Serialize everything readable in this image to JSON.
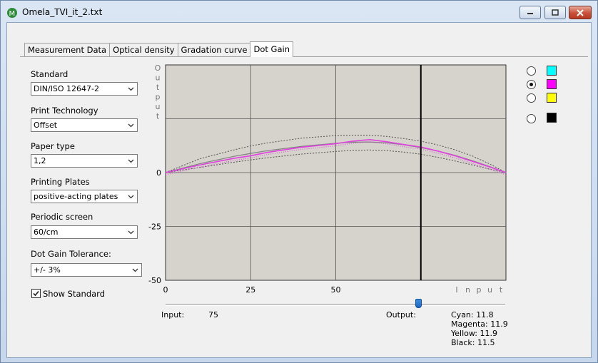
{
  "window": {
    "title": "Omela_TVI_it_2.txt",
    "minimize_icon": "minimize-icon",
    "maximize_icon": "maximize-icon",
    "close_icon": "close-icon",
    "app_icon": "omela-app-icon"
  },
  "tabs": [
    {
      "label": "Measurement Data",
      "active": false
    },
    {
      "label": "Optical density",
      "active": false
    },
    {
      "label": "Gradation curve",
      "active": false
    },
    {
      "label": "Dot Gain",
      "active": true
    }
  ],
  "form": {
    "standard_label": "Standard",
    "standard_value": "DIN/ISO 12647-2",
    "print_tech_label": "Print Technology",
    "print_tech_value": "Offset",
    "paper_type_label": "Paper type",
    "paper_type_value": "1,2",
    "printing_plates_label": "Printing Plates",
    "printing_plates_value": "positive-acting plates",
    "periodic_screen_label": "Periodic screen",
    "periodic_screen_value": "60/cm",
    "tolerance_label": "Dot Gain Tolerance:",
    "tolerance_value": "+/- 3%",
    "show_standard_label": "Show Standard",
    "show_standard_checked": true
  },
  "colors": {
    "plot_bg": "#d6d3cc",
    "grid": "#555555",
    "magenta_curve": "#e040e0",
    "standard_curve": "#808080",
    "tolerance_curve": "#505050",
    "cyan": "#00ffff",
    "magenta": "#ff00ff",
    "yellow": "#ffff00",
    "black": "#000000"
  },
  "channels": [
    {
      "name": "Cyan",
      "swatch": "#00ffff",
      "selected": false
    },
    {
      "name": "Magenta",
      "swatch": "#ff00ff",
      "selected": true
    },
    {
      "name": "Yellow",
      "swatch": "#ffff00",
      "selected": false
    },
    {
      "name": "Black",
      "swatch": "#000000",
      "selected": false
    }
  ],
  "chart_data": {
    "type": "line",
    "ylabel": "Output",
    "xlabel": "Input",
    "x_ticks": [
      "0",
      "25",
      "50"
    ],
    "y_ticks": [
      "0",
      "-25",
      "-50"
    ],
    "xlim": [
      0,
      100
    ],
    "ylim": [
      -50,
      50
    ],
    "grid": true,
    "cursor_x": 75,
    "series": [
      {
        "name": "Magenta",
        "x": [
          0,
          10,
          20,
          25,
          30,
          40,
          50,
          55,
          60,
          65,
          70,
          75,
          80,
          85,
          90,
          95,
          100
        ],
        "y": [
          0,
          3.5,
          6.6,
          7.8,
          9.4,
          11.8,
          13.4,
          14.6,
          15.3,
          14.3,
          13.0,
          11.9,
          10.0,
          7.8,
          5.3,
          2.7,
          0
        ]
      },
      {
        "x": [
          0,
          10,
          20,
          25,
          30,
          40,
          50,
          55,
          60,
          65,
          70,
          75,
          80,
          85,
          90,
          95,
          100
        ],
        "y": [
          0,
          4.1,
          7.5,
          8.9,
          10.2,
          12.2,
          13.6,
          14.1,
          14.2,
          13.8,
          12.9,
          11.6,
          10.0,
          8.0,
          5.6,
          2.9,
          0
        ]
      },
      {
        "x": [
          0,
          10,
          20,
          25,
          30,
          40,
          50,
          55,
          60,
          65,
          70,
          75,
          80,
          85,
          90,
          95,
          100
        ],
        "y": [
          0,
          6.4,
          10.5,
          12.4,
          13.8,
          16.0,
          17.2,
          17.4,
          17.4,
          16.8,
          15.8,
          14.6,
          12.8,
          10.6,
          7.8,
          4.2,
          0
        ]
      },
      {
        "x": [
          0,
          10,
          20,
          25,
          30,
          40,
          50,
          55,
          60,
          65,
          70,
          75,
          80,
          85,
          90,
          95,
          100
        ],
        "y": [
          0,
          2.4,
          4.8,
          5.9,
          6.9,
          8.6,
          9.8,
          10.3,
          10.5,
          10.2,
          9.5,
          8.5,
          7.1,
          5.4,
          3.6,
          1.7,
          0
        ]
      }
    ]
  },
  "readout": {
    "input_label": "Input:",
    "input_value": "75",
    "output_label": "Output:",
    "cyan": "Cyan: 11.8",
    "magenta": "Magenta: 11.9",
    "yellow": "Yellow: 11.9",
    "black": "Black: 11.5"
  },
  "slider": {
    "value": 75,
    "max": 100
  }
}
